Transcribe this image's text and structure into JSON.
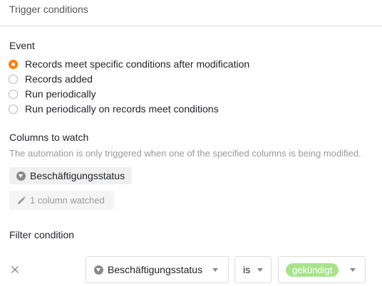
{
  "header": {
    "title": "Trigger conditions"
  },
  "event": {
    "label": "Event",
    "options": [
      {
        "label": "Records meet specific conditions after modification",
        "checked": true
      },
      {
        "label": "Records added",
        "checked": false
      },
      {
        "label": "Run periodically",
        "checked": false
      },
      {
        "label": "Run periodically on records meet conditions",
        "checked": false
      }
    ]
  },
  "columns": {
    "label": "Columns to watch",
    "hint": "The automation is only triggered when one of the specified columns is being modified.",
    "chip": "Beschäftigungsstatus",
    "watched_button": "1 column watched"
  },
  "filter": {
    "label": "Filter condition",
    "column": "Beschäftigungsstatus",
    "operator": "is",
    "value": "gekündigt",
    "value_color": "#a8e38c"
  },
  "colors": {
    "accent": "#ff8000"
  }
}
